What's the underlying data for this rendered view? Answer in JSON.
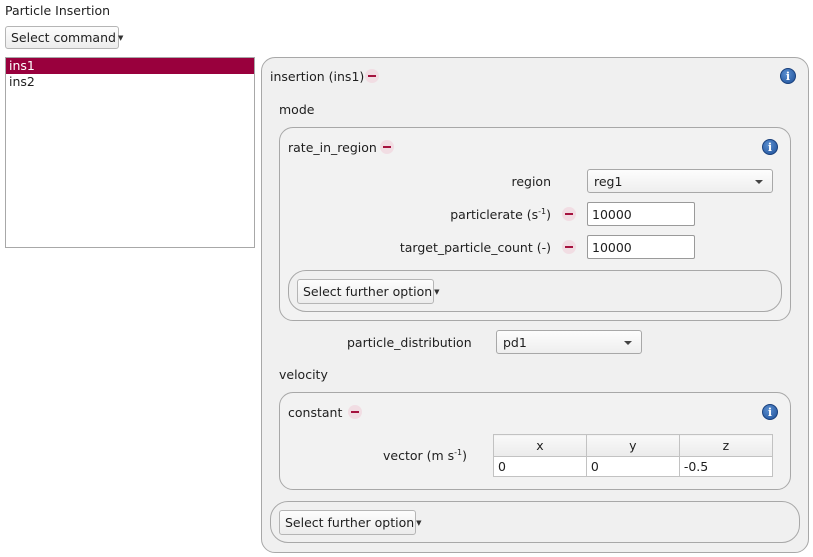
{
  "window": {
    "title": "Particle Insertion"
  },
  "toolbar": {
    "select_command_label": "Select command"
  },
  "list": {
    "items": [
      "ins1",
      "ins2"
    ],
    "selected_index": 0
  },
  "insertion": {
    "title": "insertion (ins1)",
    "mode_label": "mode",
    "mode": {
      "title": "rate_in_region",
      "region_label": "region",
      "region_value": "reg1",
      "particlerate_label": "particlerate (s",
      "particlerate_exp": "-1",
      "particlerate_close": ")",
      "particlerate_value": "10000",
      "target_label": "target_particle_count (-)",
      "target_value": "10000",
      "further_option_label": "Select further option"
    },
    "particle_distribution_label": "particle_distribution",
    "particle_distribution_value": "pd1",
    "velocity_label": "velocity",
    "velocity": {
      "title": "constant",
      "vector_label": "vector (m s",
      "vector_exp": "-1",
      "vector_close": ")",
      "columns": [
        "x",
        "y",
        "z"
      ],
      "values": [
        "0",
        "0",
        "-0.5"
      ]
    },
    "further_option_label": "Select further option"
  },
  "colors": {
    "accent": "#99003d",
    "minus": "#a5123e",
    "info": "#1d4f98"
  }
}
